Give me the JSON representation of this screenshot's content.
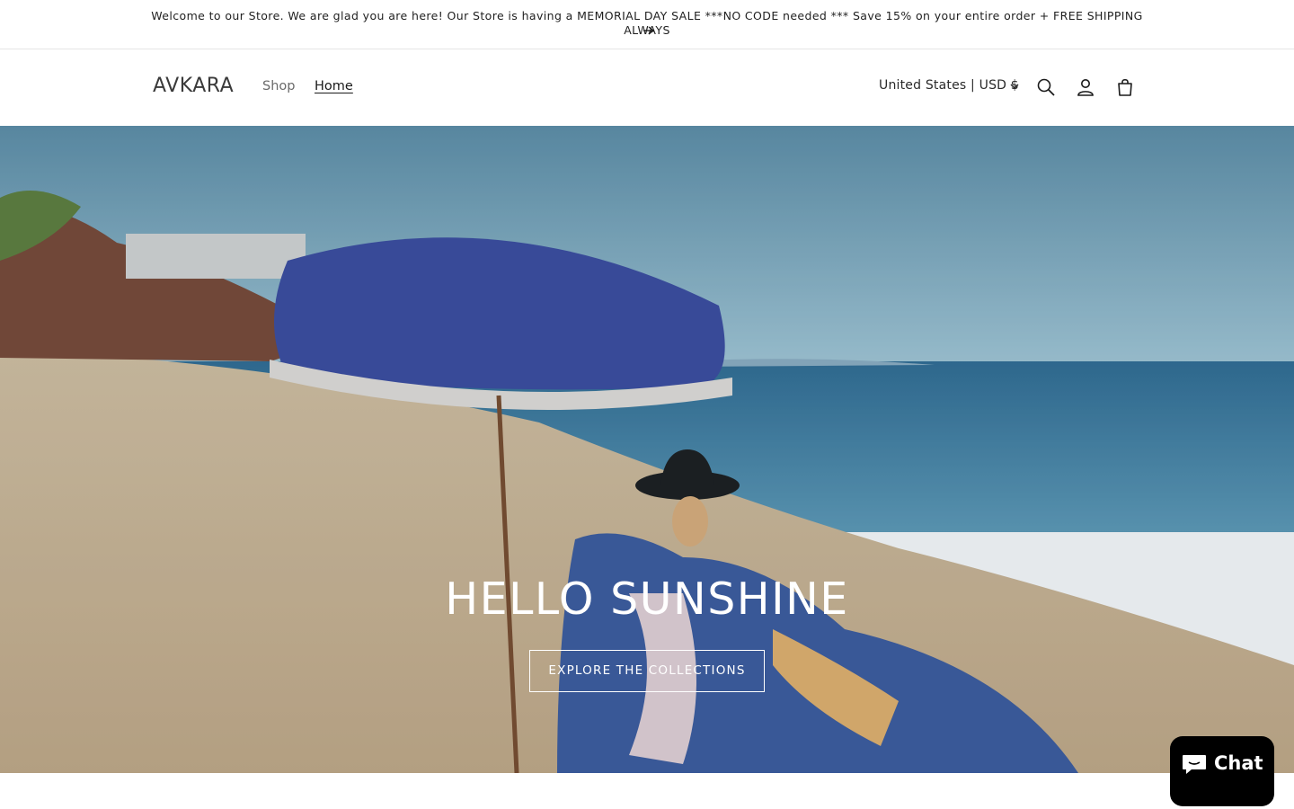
{
  "announcement": {
    "text": "Welcome to our Store. We are glad you are here! Our Store is having a MEMORIAL DAY SALE ***NO CODE needed *** Save 15% on your entire order + FREE SHIPPING ALWAYS",
    "arrow_icon": "arrow-right-icon"
  },
  "header": {
    "logo": "AVKARA",
    "nav": [
      {
        "label": "Shop",
        "active": false
      },
      {
        "label": "Home",
        "active": true
      }
    ],
    "country_selector": "United States | USD $",
    "icons": [
      "search-icon",
      "account-icon",
      "cart-icon"
    ]
  },
  "hero": {
    "title": "HELLO SUNSHINE",
    "button_label": "EXPLORE THE COLLECTIONS"
  },
  "chat": {
    "label": "Chat",
    "icon": "chat-bubble-icon"
  },
  "colors": {
    "text": "#121212",
    "chat_bg": "#000000",
    "hero_text": "#ffffff"
  }
}
